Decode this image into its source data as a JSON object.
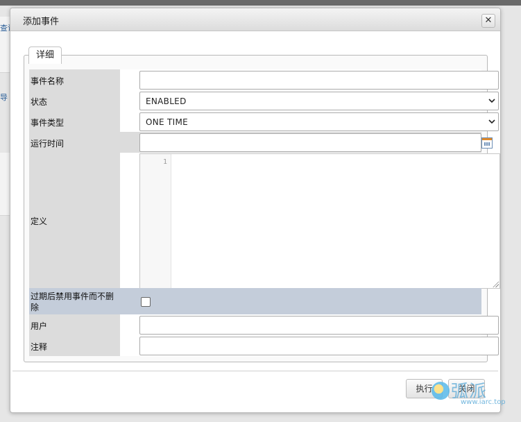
{
  "background": {
    "crumb_text": "查询",
    "side_text": "导"
  },
  "dialog": {
    "title": "添加事件",
    "close_glyph": "✕",
    "tab_label": "详细",
    "fields": {
      "event_name": {
        "label": "事件名称",
        "value": ""
      },
      "status": {
        "label": "状态",
        "value": "ENABLED"
      },
      "event_type": {
        "label": "事件类型",
        "value": "ONE TIME"
      },
      "run_time": {
        "label": "运行时间",
        "value": ""
      },
      "definition": {
        "label": "定义",
        "line_number": "1"
      },
      "disable_on_expire": {
        "label": "过期后禁用事件而不删除",
        "checked": false
      },
      "user": {
        "label": "用户",
        "value": ""
      },
      "comment": {
        "label": "注释",
        "value": ""
      }
    },
    "buttons": {
      "execute": "执行",
      "close": "关闭"
    }
  },
  "watermark": {
    "text": "弧派",
    "url": "www.iarc.top"
  },
  "icons": {
    "close": "close-icon",
    "calendar": "calendar-icon",
    "dropdown": "chevron-down-icon"
  },
  "colors": {
    "label_bg": "#dcdcdc",
    "highlight_row_bg": "#c4cdda",
    "watermark": "#5aaad8"
  }
}
